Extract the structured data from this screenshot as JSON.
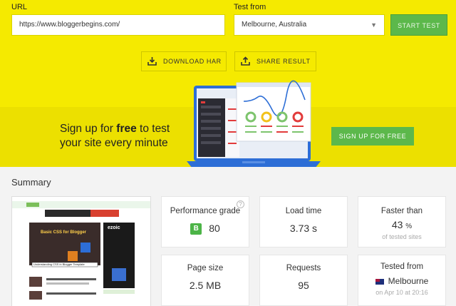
{
  "form": {
    "url_label": "URL",
    "url_value": "https://www.bloggerbegins.com/",
    "test_from_label": "Test from",
    "location_value": "Melbourne, Australia",
    "start_button": "START TEST"
  },
  "actions": {
    "download_har": "DOWNLOAD HAR",
    "share_result": "SHARE RESULT"
  },
  "promo": {
    "line1_pre": "Sign up for ",
    "line1_bold": "free",
    "line1_post": " to test",
    "line2": "your site every minute",
    "button": "SIGN UP FOR FREE"
  },
  "summary": {
    "title": "Summary",
    "performance": {
      "title": "Performance grade",
      "grade": "B",
      "score": "80"
    },
    "load_time": {
      "title": "Load time",
      "value": "3.73 s"
    },
    "faster_than": {
      "title": "Faster than",
      "value": "43",
      "unit": "%",
      "sub": "of tested sites"
    },
    "page_size": {
      "title": "Page size",
      "value": "2.5 MB"
    },
    "requests": {
      "title": "Requests",
      "value": "95"
    },
    "tested_from": {
      "title": "Tested from",
      "value": "Melbourne",
      "sub": "on Apr 10 at 20:16"
    }
  },
  "screenshot_text": {
    "heading": "Basic CSS for Blogger",
    "brand": "ezoic",
    "caption": "Understanding CSS in Blogger Template"
  },
  "colors": {
    "yellow": "#f5ea00",
    "green": "#5cb84b",
    "grade_green": "#4cb447"
  }
}
